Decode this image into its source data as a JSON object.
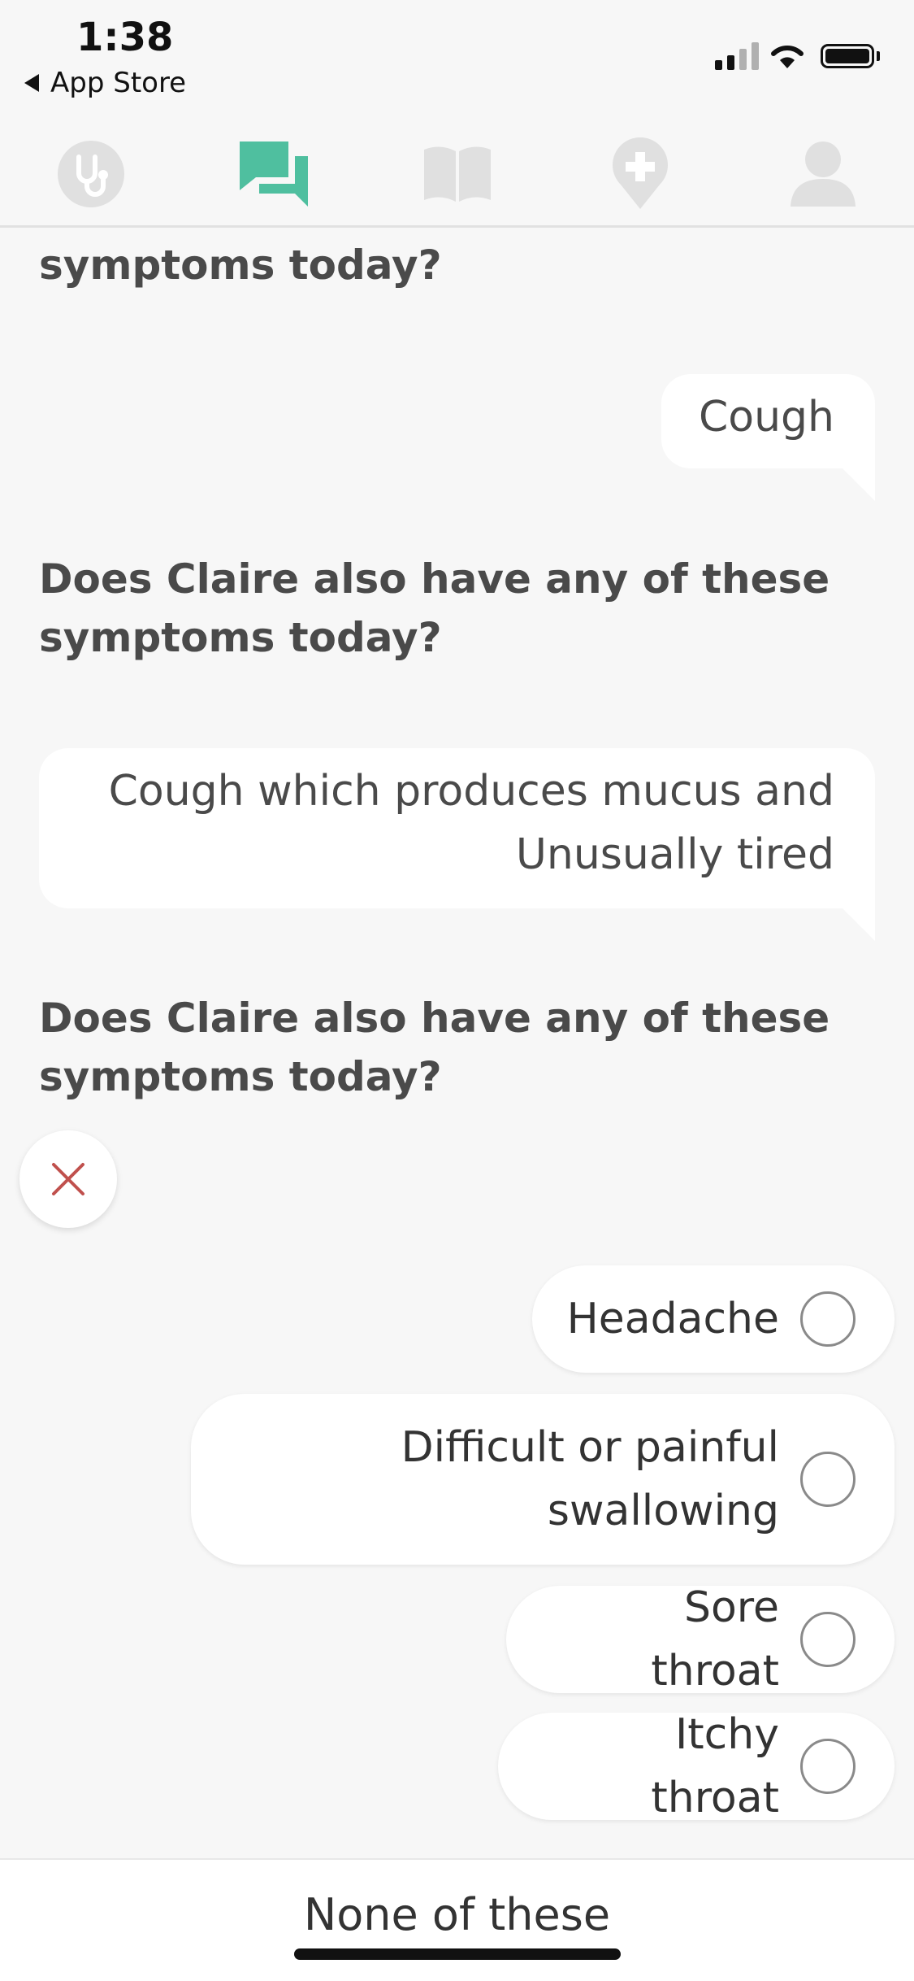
{
  "status_bar": {
    "time": "1:38",
    "back_label": "App Store"
  },
  "nav": {
    "items": [
      {
        "icon": "stethoscope-icon",
        "active": false
      },
      {
        "icon": "chat-bubbles-icon",
        "active": true
      },
      {
        "icon": "book-icon",
        "active": false
      },
      {
        "icon": "location-plus-icon",
        "active": false
      },
      {
        "icon": "person-icon",
        "active": false
      }
    ],
    "active_color": "#4fbf9f",
    "inactive_color": "#e0e0e0"
  },
  "chat": {
    "partial_question": "symptoms today?",
    "answer_1": "Cough",
    "question_2": "Does Claire also have any of these symptoms today?",
    "answer_2_line1": "Cough which produces mucus and",
    "answer_2_line2": "Unusually tired",
    "question_3": "Does Claire also have any of these symptoms today?"
  },
  "options": [
    {
      "label": "Headache",
      "checked": false
    },
    {
      "label": "Difficult or painful swallowing",
      "line1": "Difficult or painful",
      "line2": "swallowing",
      "checked": false
    },
    {
      "label": "Sore throat",
      "checked": false
    },
    {
      "label": "Itchy throat",
      "checked": false
    }
  ],
  "footer": {
    "none_label": "None of these"
  },
  "colors": {
    "close_x": "#c0504d",
    "background": "#f7f7f7"
  }
}
